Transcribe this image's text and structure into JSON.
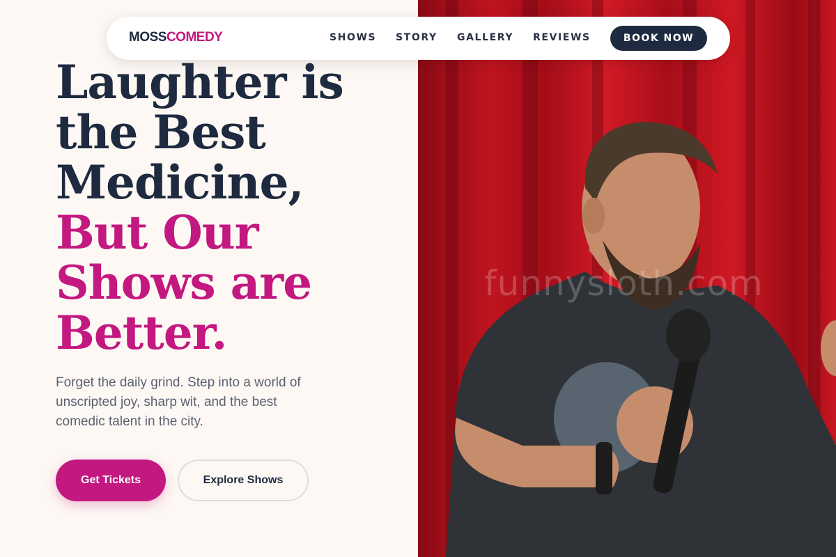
{
  "nav": {
    "logo_part1": "MOSS",
    "logo_part2": "COMEDY",
    "links": [
      "SHOWS",
      "STORY",
      "GALLERY",
      "REVIEWS"
    ],
    "cta": "BOOK NOW"
  },
  "hero": {
    "headline_dark": [
      "Laughter is",
      "the Best",
      "Medicine,"
    ],
    "headline_pink": [
      "But Our",
      "Shows are",
      "Better."
    ],
    "subtitle_lines": [
      "Forget the daily grind. Step into a world of",
      "unscripted joy, sharp wit, and the best",
      "comedic talent in the city."
    ],
    "primary_button": "Get Tickets",
    "secondary_button": "Explore Shows"
  },
  "photo": {
    "watermark": "funnysloth.com",
    "subject": "comedian-with-microphone"
  },
  "colors": {
    "brand_dark": "#1e2a3f",
    "brand_pink": "#c2187f",
    "background": "#fdf8f4",
    "curtain_red": "#c0141f"
  }
}
